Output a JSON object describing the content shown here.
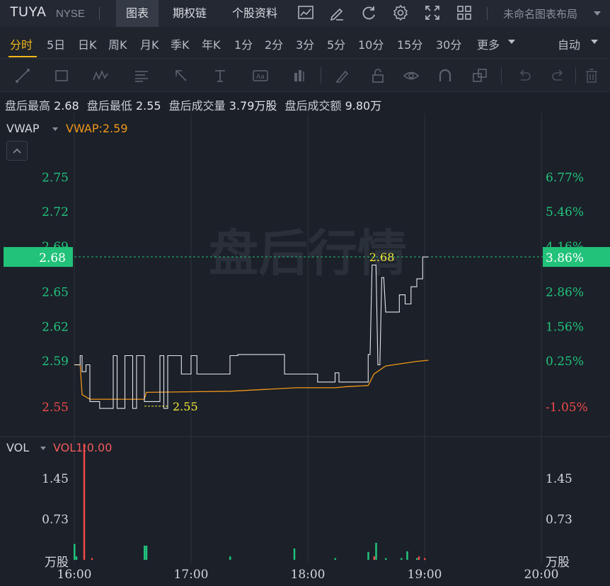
{
  "header": {
    "ticker": "TUYA",
    "exchange": "NYSE",
    "tabs": [
      {
        "label": "图表",
        "active": true
      },
      {
        "label": "期权链",
        "active": false
      },
      {
        "label": "个股资料",
        "active": false
      }
    ],
    "icons": [
      "chart-compare-icon",
      "draw-pen-icon",
      "refresh-icon",
      "settings-icon",
      "fullscreen-icon",
      "layout-grid-icon"
    ],
    "layout_name": "未命名图表布局"
  },
  "periods": {
    "items": [
      "分时",
      "5日",
      "日K",
      "周K",
      "月K",
      "季K",
      "年K",
      "1分",
      "2分",
      "3分",
      "5分",
      "10分",
      "15分",
      "30分"
    ],
    "active": "分时",
    "more_label": "更多",
    "auto_label": "自动"
  },
  "draw_tools": [
    "line-tool-icon",
    "rectangle-tool-icon",
    "wave-tool-icon",
    "fib-tool-icon",
    "arrow-tool-icon",
    "text-tool-icon",
    "label-tool-icon",
    "bar-tool-icon",
    "pen-tool-icon",
    "lock-icon",
    "eye-icon",
    "magnet-icon",
    "layers-icon",
    "undo-icon",
    "redo-icon",
    "trash-icon"
  ],
  "info": {
    "hi_label": "盘后最高",
    "hi": "2.68",
    "lo_label": "盘后最低",
    "lo": "2.55",
    "vol_label": "盘后成交量",
    "vol": "3.79万股",
    "amt_label": "盘后成交额",
    "amt": "9.80万"
  },
  "indicators": {
    "main_name": "VWAP",
    "main_value": "VWAP:2.59",
    "sub_name": "VOL",
    "sub_value": "VOL1:0.00"
  },
  "watermark": "盘后行情",
  "colors": {
    "up": "#22c27a",
    "down": "#f04a4a",
    "vwap": "#f0961a",
    "price_line": "#e4e6ea",
    "marker_text": "#f2e93a",
    "tag_bg": "#22c27a"
  },
  "chart_data": {
    "type": "line",
    "x_ticks": [
      "16:00",
      "17:00",
      "18:00",
      "19:00",
      "20:00"
    ],
    "y_ticks": [
      {
        "price": 2.75,
        "pct": "6.77%"
      },
      {
        "price": 2.72,
        "pct": "5.46%"
      },
      {
        "price": 2.69,
        "pct": "4.16%"
      },
      {
        "price": 2.65,
        "pct": "2.86%"
      },
      {
        "price": 2.62,
        "pct": "1.56%"
      },
      {
        "price": 2.59,
        "pct": "0.25%"
      },
      {
        "price": 2.55,
        "pct": "-1.05%"
      }
    ],
    "ref_price": 2.584,
    "current_price": "2.68",
    "current_pct": "3.86%",
    "high_label": "2.68",
    "low_label": "2.55",
    "series": [
      {
        "name": "price",
        "points": [
          [
            0,
            2.586
          ],
          [
            3,
            2.586
          ],
          [
            3,
            2.594
          ],
          [
            4,
            2.594
          ],
          [
            4,
            2.58
          ],
          [
            6,
            2.58
          ],
          [
            6,
            2.586
          ],
          [
            8,
            2.586
          ],
          [
            8,
            2.554
          ],
          [
            13,
            2.554
          ],
          [
            13,
            2.548
          ],
          [
            20,
            2.548
          ],
          [
            20,
            2.594
          ],
          [
            22,
            2.594
          ],
          [
            22,
            2.548
          ],
          [
            26,
            2.548
          ],
          [
            26,
            2.594
          ],
          [
            30,
            2.594
          ],
          [
            30,
            2.548
          ],
          [
            32,
            2.548
          ],
          [
            32,
            2.594
          ],
          [
            36,
            2.594
          ],
          [
            36,
            2.554
          ],
          [
            44,
            2.554
          ],
          [
            44,
            2.594
          ],
          [
            46,
            2.594
          ],
          [
            46,
            2.548
          ],
          [
            48,
            2.548
          ],
          [
            48,
            2.594
          ],
          [
            55,
            2.594
          ],
          [
            55,
            2.578
          ],
          [
            60,
            2.578
          ],
          [
            60,
            2.594
          ],
          [
            63,
            2.594
          ],
          [
            63,
            2.578
          ],
          [
            80,
            2.578
          ],
          [
            80,
            2.594
          ],
          [
            84,
            2.594
          ],
          [
            84,
            2.595
          ],
          [
            108,
            2.595
          ],
          [
            108,
            2.578
          ],
          [
            125,
            2.578
          ],
          [
            125,
            2.571
          ],
          [
            134,
            2.571
          ],
          [
            134,
            2.579
          ],
          [
            136,
            2.579
          ],
          [
            136,
            2.571
          ],
          [
            151,
            2.571
          ],
          [
            151,
            2.595
          ],
          [
            152,
            2.595
          ],
          [
            153,
            2.673
          ],
          [
            155,
            2.673
          ],
          [
            156,
            2.586
          ],
          [
            157,
            2.586
          ],
          [
            158,
            2.662
          ],
          [
            159,
            2.662
          ],
          [
            160,
            2.632
          ],
          [
            167,
            2.632
          ],
          [
            167,
            2.647
          ],
          [
            170,
            2.647
          ],
          [
            170,
            2.639
          ],
          [
            173,
            2.639
          ],
          [
            173,
            2.654
          ],
          [
            176,
            2.654
          ],
          [
            176,
            2.661
          ],
          [
            179,
            2.661
          ],
          [
            179,
            2.68
          ],
          [
            182,
            2.68
          ]
        ]
      },
      {
        "name": "VWAP",
        "points": [
          [
            0,
            2.586
          ],
          [
            3,
            2.586
          ],
          [
            4,
            2.56
          ],
          [
            8,
            2.556
          ],
          [
            30,
            2.556
          ],
          [
            36,
            2.556
          ],
          [
            37,
            2.562
          ],
          [
            80,
            2.563
          ],
          [
            114,
            2.566
          ],
          [
            134,
            2.566
          ],
          [
            140,
            2.567
          ],
          [
            151,
            2.568
          ],
          [
            154,
            2.578
          ],
          [
            160,
            2.585
          ],
          [
            168,
            2.587
          ],
          [
            176,
            2.589
          ],
          [
            182,
            2.59
          ]
        ]
      }
    ],
    "volume": {
      "unit": "万股",
      "y_ticks": [
        1.45,
        0.73
      ],
      "bars": [
        {
          "t": 0,
          "v": 0.28,
          "dir": "up"
        },
        {
          "t": 1,
          "v": 0.06,
          "dir": "up"
        },
        {
          "t": 5,
          "v": 2.05,
          "dir": "down"
        },
        {
          "t": 9,
          "v": 0.03,
          "dir": "down"
        },
        {
          "t": 36,
          "v": 0.25,
          "dir": "up"
        },
        {
          "t": 37,
          "v": 0.25,
          "dir": "up"
        },
        {
          "t": 80,
          "v": 0.06,
          "dir": "up"
        },
        {
          "t": 113,
          "v": 0.2,
          "dir": "up"
        },
        {
          "t": 134,
          "v": 0.03,
          "dir": "up"
        },
        {
          "t": 151,
          "v": 0.14,
          "dir": "up"
        },
        {
          "t": 154,
          "v": 0.06,
          "dir": "down"
        },
        {
          "t": 155,
          "v": 0.3,
          "dir": "up"
        },
        {
          "t": 160,
          "v": 0.03,
          "dir": "up"
        },
        {
          "t": 168,
          "v": 0.03,
          "dir": "up"
        },
        {
          "t": 171,
          "v": 0.15,
          "dir": "up"
        },
        {
          "t": 176,
          "v": 0.03,
          "dir": "up"
        },
        {
          "t": 177,
          "v": 0.06,
          "dir": "down"
        },
        {
          "t": 180,
          "v": 0.03,
          "dir": "down"
        }
      ]
    }
  }
}
